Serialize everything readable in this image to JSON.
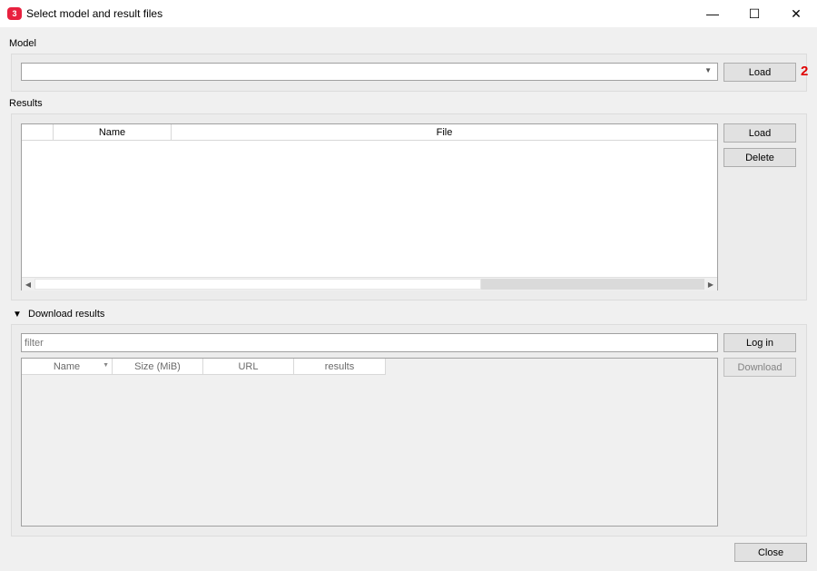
{
  "window": {
    "title": "Select model and result files",
    "icon_name": "app-logo-icon",
    "controls": {
      "minimize": "—",
      "maximize": "☐",
      "close": "✕"
    }
  },
  "model": {
    "label": "Model",
    "combo_value": "",
    "load_label": "Load",
    "annotation": "2"
  },
  "results": {
    "label": "Results",
    "columns": [
      "",
      "Name",
      "File"
    ],
    "load_label": "Load",
    "delete_label": "Delete"
  },
  "download": {
    "label": "Download results",
    "filter_placeholder": "filter",
    "login_label": "Log in",
    "download_label": "Download",
    "columns": [
      "Name",
      "Size (MiB)",
      "URL",
      "results"
    ]
  },
  "footer": {
    "close_label": "Close"
  },
  "colors": {
    "annotation": "#e00000",
    "accent_icon": "#e8213f"
  }
}
